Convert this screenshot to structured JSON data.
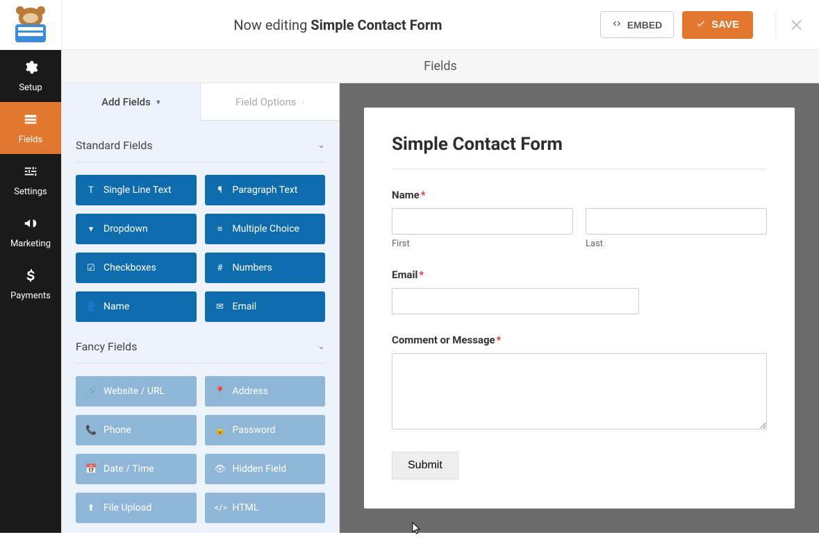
{
  "header": {
    "editing_prefix": "Now editing ",
    "form_name": "Simple Contact Form",
    "embed_label": "EMBED",
    "save_label": "SAVE"
  },
  "section_title": "Fields",
  "vnav": {
    "setup": "Setup",
    "fields": "Fields",
    "settings": "Settings",
    "marketing": "Marketing",
    "payments": "Payments"
  },
  "panel": {
    "tab_add": "Add Fields",
    "tab_options": "Field Options",
    "group_standard": "Standard Fields",
    "group_fancy": "Fancy Fields",
    "standard": {
      "single_line": "Single Line Text",
      "paragraph": "Paragraph Text",
      "dropdown": "Dropdown",
      "multiple_choice": "Multiple Choice",
      "checkboxes": "Checkboxes",
      "numbers": "Numbers",
      "name": "Name",
      "email": "Email"
    },
    "fancy": {
      "website": "Website / URL",
      "address": "Address",
      "phone": "Phone",
      "password": "Password",
      "datetime": "Date / Time",
      "hidden": "Hidden Field",
      "fileupload": "File Upload",
      "html": "HTML"
    }
  },
  "form": {
    "title": "Simple Contact Form",
    "name_label": "Name",
    "first_label": "First",
    "last_label": "Last",
    "email_label": "Email",
    "message_label": "Comment or Message",
    "submit_label": "Submit",
    "required_marker": "*"
  },
  "colors": {
    "accent": "#e27730",
    "field_primary": "#0e6cad",
    "field_secondary": "#8fb6d6"
  }
}
